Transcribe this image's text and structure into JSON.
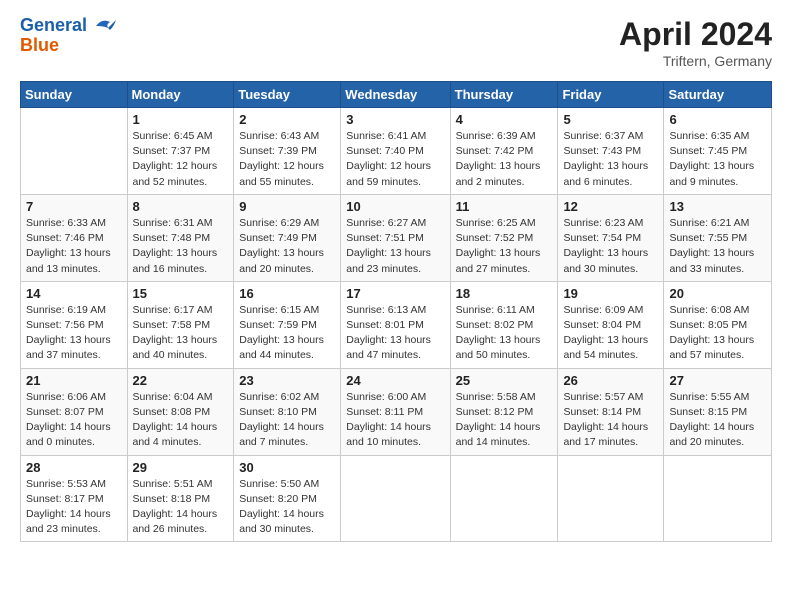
{
  "header": {
    "logo_line1": "General",
    "logo_line2": "Blue",
    "month_title": "April 2024",
    "location": "Triftern, Germany"
  },
  "weekdays": [
    "Sunday",
    "Monday",
    "Tuesday",
    "Wednesday",
    "Thursday",
    "Friday",
    "Saturday"
  ],
  "weeks": [
    [
      {
        "day": "",
        "info": ""
      },
      {
        "day": "1",
        "info": "Sunrise: 6:45 AM\nSunset: 7:37 PM\nDaylight: 12 hours\nand 52 minutes."
      },
      {
        "day": "2",
        "info": "Sunrise: 6:43 AM\nSunset: 7:39 PM\nDaylight: 12 hours\nand 55 minutes."
      },
      {
        "day": "3",
        "info": "Sunrise: 6:41 AM\nSunset: 7:40 PM\nDaylight: 12 hours\nand 59 minutes."
      },
      {
        "day": "4",
        "info": "Sunrise: 6:39 AM\nSunset: 7:42 PM\nDaylight: 13 hours\nand 2 minutes."
      },
      {
        "day": "5",
        "info": "Sunrise: 6:37 AM\nSunset: 7:43 PM\nDaylight: 13 hours\nand 6 minutes."
      },
      {
        "day": "6",
        "info": "Sunrise: 6:35 AM\nSunset: 7:45 PM\nDaylight: 13 hours\nand 9 minutes."
      }
    ],
    [
      {
        "day": "7",
        "info": "Sunrise: 6:33 AM\nSunset: 7:46 PM\nDaylight: 13 hours\nand 13 minutes."
      },
      {
        "day": "8",
        "info": "Sunrise: 6:31 AM\nSunset: 7:48 PM\nDaylight: 13 hours\nand 16 minutes."
      },
      {
        "day": "9",
        "info": "Sunrise: 6:29 AM\nSunset: 7:49 PM\nDaylight: 13 hours\nand 20 minutes."
      },
      {
        "day": "10",
        "info": "Sunrise: 6:27 AM\nSunset: 7:51 PM\nDaylight: 13 hours\nand 23 minutes."
      },
      {
        "day": "11",
        "info": "Sunrise: 6:25 AM\nSunset: 7:52 PM\nDaylight: 13 hours\nand 27 minutes."
      },
      {
        "day": "12",
        "info": "Sunrise: 6:23 AM\nSunset: 7:54 PM\nDaylight: 13 hours\nand 30 minutes."
      },
      {
        "day": "13",
        "info": "Sunrise: 6:21 AM\nSunset: 7:55 PM\nDaylight: 13 hours\nand 33 minutes."
      }
    ],
    [
      {
        "day": "14",
        "info": "Sunrise: 6:19 AM\nSunset: 7:56 PM\nDaylight: 13 hours\nand 37 minutes."
      },
      {
        "day": "15",
        "info": "Sunrise: 6:17 AM\nSunset: 7:58 PM\nDaylight: 13 hours\nand 40 minutes."
      },
      {
        "day": "16",
        "info": "Sunrise: 6:15 AM\nSunset: 7:59 PM\nDaylight: 13 hours\nand 44 minutes."
      },
      {
        "day": "17",
        "info": "Sunrise: 6:13 AM\nSunset: 8:01 PM\nDaylight: 13 hours\nand 47 minutes."
      },
      {
        "day": "18",
        "info": "Sunrise: 6:11 AM\nSunset: 8:02 PM\nDaylight: 13 hours\nand 50 minutes."
      },
      {
        "day": "19",
        "info": "Sunrise: 6:09 AM\nSunset: 8:04 PM\nDaylight: 13 hours\nand 54 minutes."
      },
      {
        "day": "20",
        "info": "Sunrise: 6:08 AM\nSunset: 8:05 PM\nDaylight: 13 hours\nand 57 minutes."
      }
    ],
    [
      {
        "day": "21",
        "info": "Sunrise: 6:06 AM\nSunset: 8:07 PM\nDaylight: 14 hours\nand 0 minutes."
      },
      {
        "day": "22",
        "info": "Sunrise: 6:04 AM\nSunset: 8:08 PM\nDaylight: 14 hours\nand 4 minutes."
      },
      {
        "day": "23",
        "info": "Sunrise: 6:02 AM\nSunset: 8:10 PM\nDaylight: 14 hours\nand 7 minutes."
      },
      {
        "day": "24",
        "info": "Sunrise: 6:00 AM\nSunset: 8:11 PM\nDaylight: 14 hours\nand 10 minutes."
      },
      {
        "day": "25",
        "info": "Sunrise: 5:58 AM\nSunset: 8:12 PM\nDaylight: 14 hours\nand 14 minutes."
      },
      {
        "day": "26",
        "info": "Sunrise: 5:57 AM\nSunset: 8:14 PM\nDaylight: 14 hours\nand 17 minutes."
      },
      {
        "day": "27",
        "info": "Sunrise: 5:55 AM\nSunset: 8:15 PM\nDaylight: 14 hours\nand 20 minutes."
      }
    ],
    [
      {
        "day": "28",
        "info": "Sunrise: 5:53 AM\nSunset: 8:17 PM\nDaylight: 14 hours\nand 23 minutes."
      },
      {
        "day": "29",
        "info": "Sunrise: 5:51 AM\nSunset: 8:18 PM\nDaylight: 14 hours\nand 26 minutes."
      },
      {
        "day": "30",
        "info": "Sunrise: 5:50 AM\nSunset: 8:20 PM\nDaylight: 14 hours\nand 30 minutes."
      },
      {
        "day": "",
        "info": ""
      },
      {
        "day": "",
        "info": ""
      },
      {
        "day": "",
        "info": ""
      },
      {
        "day": "",
        "info": ""
      }
    ]
  ]
}
